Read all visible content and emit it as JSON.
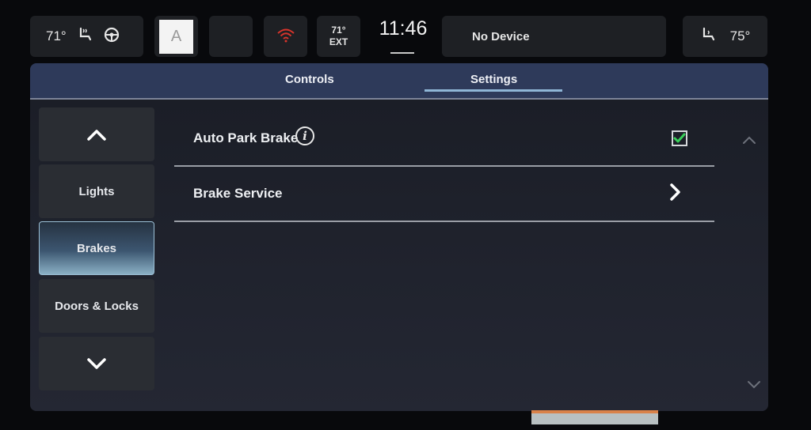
{
  "status_bar": {
    "left_temp": "71°",
    "a_label": "A",
    "ext_temp": "71°",
    "ext_label": "EXT",
    "clock": "11:46",
    "device": "No Device",
    "right_temp": "75°"
  },
  "tabs": [
    {
      "label": "Controls",
      "selected": false
    },
    {
      "label": "Settings",
      "selected": true
    }
  ],
  "sidebar": {
    "items": [
      {
        "label": "Lights",
        "selected": false
      },
      {
        "label": "Brakes",
        "selected": true
      },
      {
        "label": "Doors & Locks",
        "selected": false
      }
    ]
  },
  "settings": {
    "rows": [
      {
        "label": "Auto Park Brake",
        "control": "checkbox",
        "checked": true
      },
      {
        "label": "Brake Service",
        "control": "chevron"
      }
    ]
  },
  "colors": {
    "tab_bar": "#2e3a5a",
    "active_item": "#8ab0c5",
    "checkbox_check": "#39d05a",
    "wifi_icon": "#d9342b"
  }
}
